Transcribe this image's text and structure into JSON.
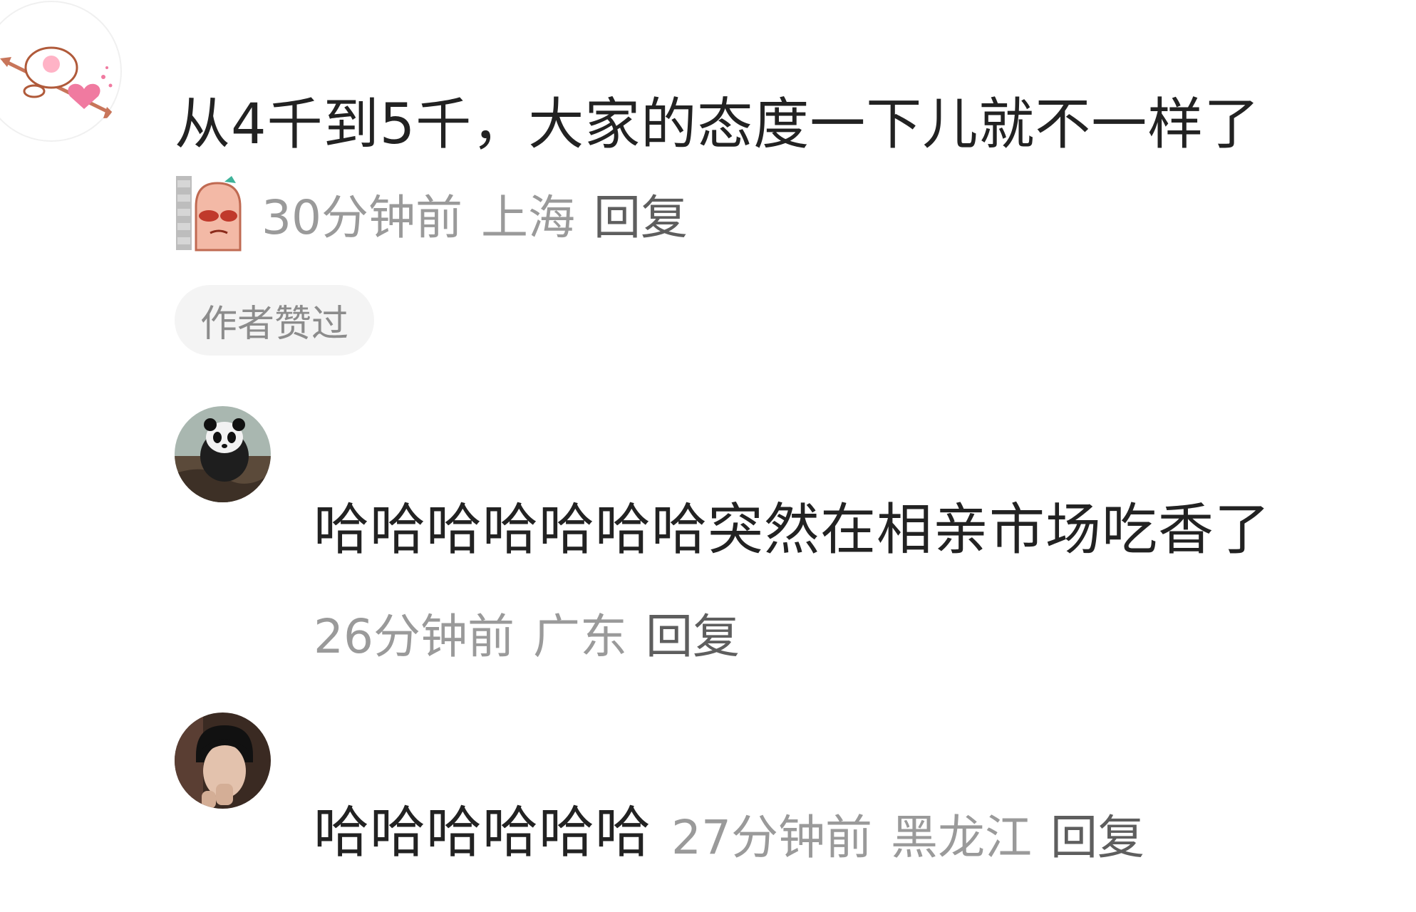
{
  "comments": [
    {
      "text": "从4千到5千，大家的态度一下儿就不一样了",
      "time": "30分钟前",
      "location": "上海",
      "reply_label": "回复",
      "badge": "作者赞过",
      "avatar_icon": "cupid-cartoon-avatar",
      "sticker_icon": "peeking-sausage-sticker"
    },
    {
      "text": "哈哈哈哈哈哈哈突然在相亲市场吃香了",
      "time": "26分钟前",
      "location": "广东",
      "reply_label": "回复",
      "avatar_icon": "panda-photo-avatar"
    },
    {
      "text": "哈哈哈哈哈哈",
      "time": "27分钟前",
      "location": "黑龙江",
      "reply_label": "回复",
      "avatar_icon": "person-photo-avatar"
    }
  ],
  "colors": {
    "text": "#222222",
    "meta": "#9a9a9a",
    "reply": "#5e5e5e",
    "badge_bg": "#f4f4f4"
  }
}
